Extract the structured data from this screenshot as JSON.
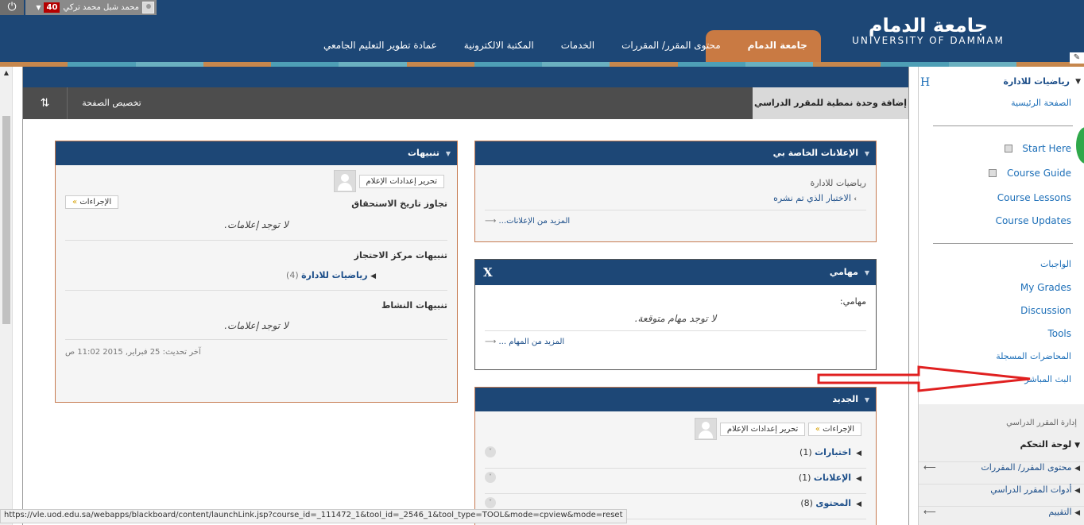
{
  "topbar": {
    "user_name": "محمد شبل محمد تركي",
    "notification_count": "40",
    "logo_ar": "جامعة الدمام",
    "logo_en": "UNIVERSITY OF DAMMAM",
    "tabs": [
      {
        "label": "جامعة الدمام"
      },
      {
        "label": "محتوى المقرر/ المقررات"
      },
      {
        "label": "الخدمات"
      },
      {
        "label": "المكتبة الالكترونية"
      },
      {
        "label": "عمادة تطوير التعليم الجامعي"
      }
    ],
    "stripe_colors": [
      "#c6874d",
      "#4e9fb6",
      "#6ab0c0",
      "#c6874d",
      "#4e9fb6",
      "#6ab0c0",
      "#c6874d",
      "#4e9fb6",
      "#6ab0c0",
      "#c6874d",
      "#4e9fb6",
      "#6ab0c0",
      "#c6874d",
      "#4e9fb6",
      "#6ab0c0",
      "#c6874d"
    ]
  },
  "toolbar": {
    "add_module_label": "إضافة وحدة نمطية للمقرر الدراسي",
    "customize_label": "تخصيص الصفحة",
    "sort_icon": "⇅"
  },
  "announcements": {
    "title": "الإعلانات الخاصة بي",
    "course": "رياضيات للادارة",
    "item": "الاختبار الذي تم نشره",
    "more": "المزيد من الإعلانات..."
  },
  "tasks": {
    "title": "مهامي",
    "close_label": "X",
    "label": "مهامي:",
    "empty": "لا توجد مهام متوقعة.",
    "more": "المزيد من المهام ..."
  },
  "whats_new": {
    "title": "الجديد",
    "actions_label": "الإجراءات",
    "edit_settings_label": "تحرير إعدادات الإعلام",
    "rows": [
      {
        "label": "اختبارات",
        "count": "(1)"
      },
      {
        "label": "الإعلانات",
        "count": "(1)"
      },
      {
        "label": "المحتوى",
        "count": "(8)"
      }
    ]
  },
  "alerts": {
    "title": "تنبيهات",
    "edit_settings_label": "تحرير إعدادات الإعلام",
    "actions_label": "الإجراءات",
    "past_due_title": "تجاوز تاريخ الاستحقاق",
    "past_due_empty": "لا توجد إعلامات.",
    "retention_title": "تنبيهات مركز الاحتجاز",
    "retention_course": "رياضيات للادارة",
    "retention_count": "(4)",
    "activity_title": "تنبيهات النشاط",
    "activity_empty": "لا توجد إعلامات.",
    "last_updated": "آخر تحديث: 25 فبراير, 2015 11:02 ص"
  },
  "sidebar": {
    "course_title": "رياضيات للادارة",
    "home": "الصفحة الرئيسية",
    "h_icon": "H",
    "items": [
      {
        "label": "Start Here"
      },
      {
        "label": "Course Guide"
      },
      {
        "label": "Course Lessons"
      },
      {
        "label": "Course Updates"
      }
    ],
    "items2": [
      {
        "label": "الواجبات"
      },
      {
        "label": "My Grades"
      },
      {
        "label": "Discussion"
      },
      {
        "label": "Tools"
      },
      {
        "label": "المحاضرات المسجلة"
      },
      {
        "label": "البث المباشر"
      }
    ],
    "course_management": "إدارة المقرر الدراسي",
    "control_panel": "لوحة التحكم",
    "cp_items": [
      {
        "label": "محتوى المقرر/ المقررات"
      },
      {
        "label": "أدوات المقرر الدراسي"
      },
      {
        "label": "التقييم"
      }
    ]
  },
  "statusbar": {
    "url": "https://vle.uod.edu.sa/webapps/blackboard/content/launchLink.jsp?course_id=_111472_1&tool_id=_2546_1&tool_type=TOOL&mode=cpview&mode=reset"
  }
}
